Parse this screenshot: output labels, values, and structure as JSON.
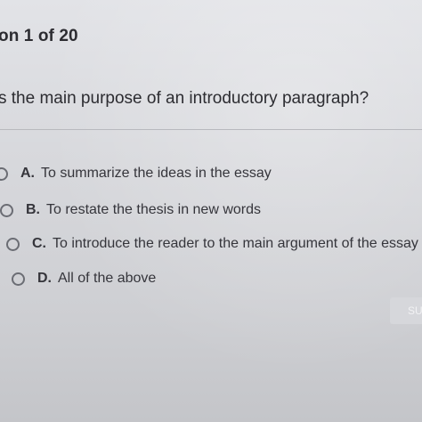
{
  "header": {
    "counter_text": "on 1 of 20"
  },
  "question": {
    "text": "s the main purpose of an introductory paragraph?"
  },
  "options": [
    {
      "letter": "A.",
      "text": "To summarize the ideas in the essay"
    },
    {
      "letter": "B.",
      "text": "To restate the thesis in new words"
    },
    {
      "letter": "C.",
      "text": "To introduce the reader to the main argument of the essay"
    },
    {
      "letter": "D.",
      "text": "All of the above"
    }
  ],
  "submit": {
    "label": "SU"
  }
}
